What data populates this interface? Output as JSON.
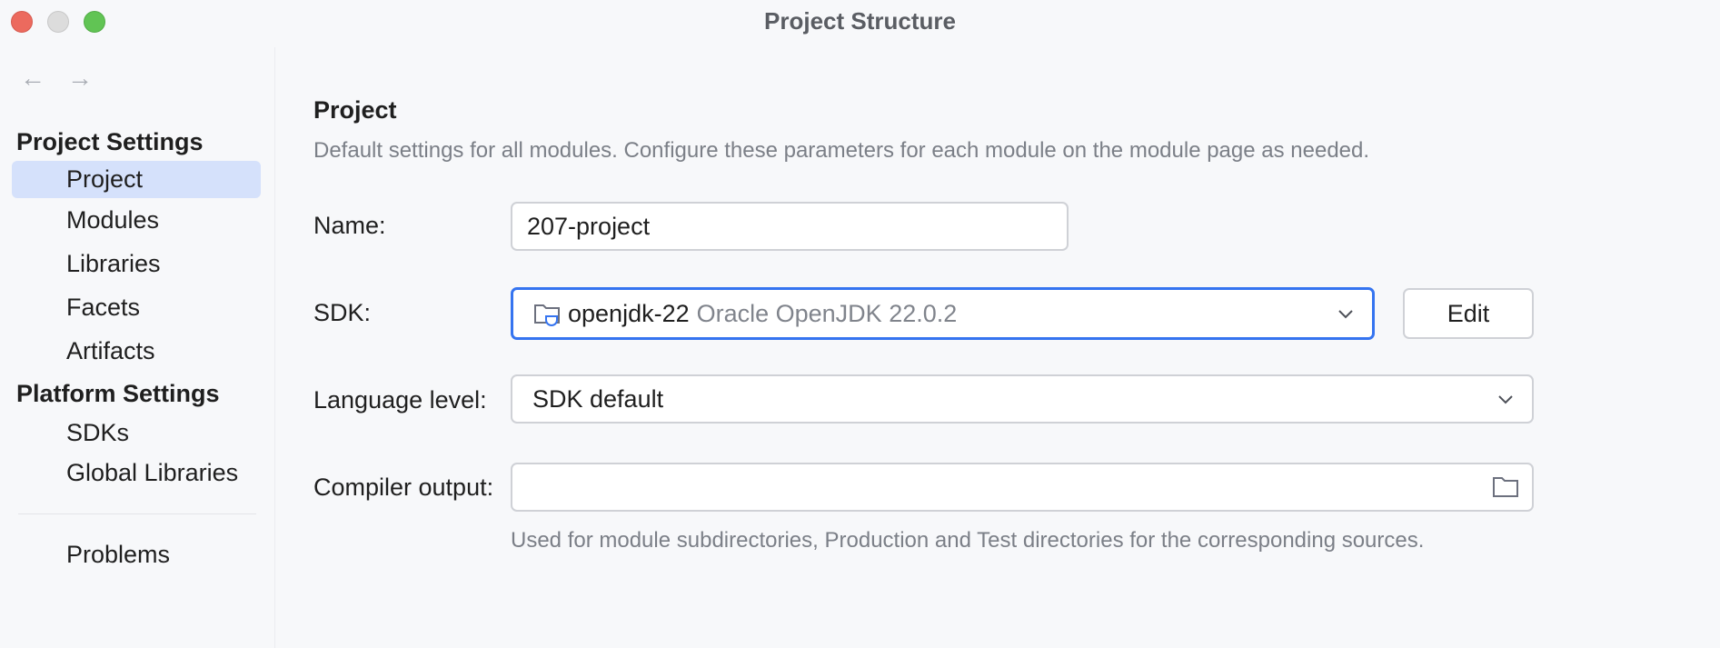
{
  "window": {
    "title": "Project Structure"
  },
  "sidebar": {
    "back_icon": "arrow-left-icon",
    "forward_icon": "arrow-right-icon",
    "project_settings_header": "Project Settings",
    "platform_settings_header": "Platform Settings",
    "items": [
      {
        "label": "Project",
        "selected": true
      },
      {
        "label": "Modules"
      },
      {
        "label": "Libraries"
      },
      {
        "label": "Facets"
      },
      {
        "label": "Artifacts"
      },
      {
        "label": "SDKs"
      },
      {
        "label": "Global Libraries"
      },
      {
        "label": "Problems"
      }
    ]
  },
  "main": {
    "heading": "Project",
    "description": "Default settings for all modules. Configure these parameters for each module on the module page as needed.",
    "name": {
      "label": "Name:",
      "value": "207-project"
    },
    "sdk": {
      "label": "SDK:",
      "name": "openjdk-22",
      "detail": "Oracle OpenJDK 22.0.2",
      "icon": "jdk-folder-icon",
      "edit_label": "Edit"
    },
    "language_level": {
      "label": "Language level:",
      "value": "SDK default"
    },
    "compiler_output": {
      "label": "Compiler output:",
      "value": "",
      "hint": "Used for module subdirectories, Production and Test directories for the corresponding sources."
    }
  },
  "colors": {
    "accent": "#3574f0",
    "selection": "#d5e1fb",
    "secondary_text": "#7b7f87"
  }
}
